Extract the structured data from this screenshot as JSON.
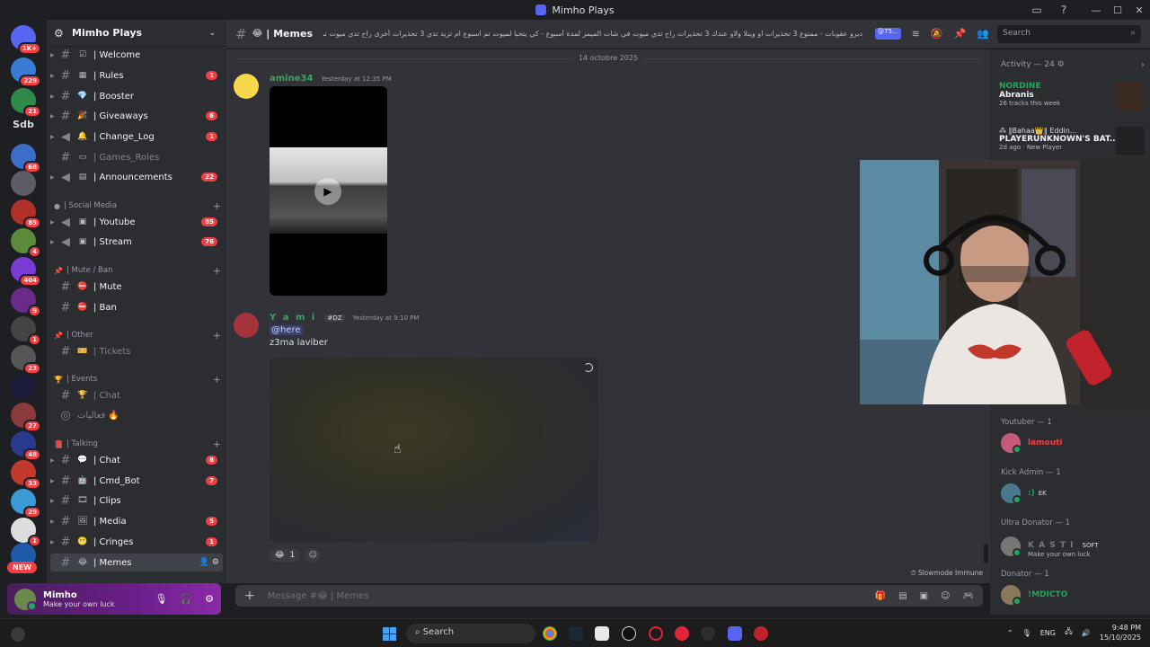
{
  "window": {
    "title": "Mimho Plays",
    "controls": [
      "—",
      "☐",
      "✕"
    ]
  },
  "rail": {
    "servers": [
      {
        "name": "home",
        "badge": "1K+",
        "color": "#5865f2"
      },
      {
        "name": "server-1",
        "badge": "229",
        "color": "#3a7bd5"
      },
      {
        "name": "server-2",
        "badge": "21",
        "color": "#2f8a4a"
      },
      {
        "name": "server-4",
        "badge": "68",
        "color": "#3b6ec7"
      },
      {
        "name": "server-5",
        "badge": "",
        "color": "#dbdee1"
      },
      {
        "name": "server-6",
        "badge": "85",
        "color": "#b0302a"
      },
      {
        "name": "server-7",
        "badge": "4",
        "color": "#5a8a3a"
      },
      {
        "name": "server-8",
        "badge": "404",
        "color": "#7a3ad5"
      },
      {
        "name": "server-9",
        "badge": "9",
        "color": "#6a2a8a"
      },
      {
        "name": "server-10",
        "badge": "1",
        "color": "#444"
      },
      {
        "name": "server-11",
        "badge": "23",
        "color": "#555"
      },
      {
        "name": "server-12",
        "badge": "",
        "color": "#1b1b3a"
      },
      {
        "name": "server-13",
        "badge": "27",
        "color": "#8a3a3a"
      },
      {
        "name": "server-14",
        "badge": "48",
        "color": "#2a3a8a"
      },
      {
        "name": "server-15",
        "badge": "33",
        "color": "#c0392b"
      },
      {
        "name": "server-16",
        "badge": "29",
        "color": "#3a9ad5"
      },
      {
        "name": "server-17",
        "badge": "1",
        "color": "#eee"
      },
      {
        "name": "server-18",
        "badge": "",
        "color": "#1e5aa8"
      }
    ],
    "text_server": "Sdb",
    "new_label": "NEW"
  },
  "guild": {
    "name": "Mimho Plays"
  },
  "channels": [
    {
      "name": "| Welcome",
      "emoji": "☑",
      "badge": ""
    },
    {
      "name": "| Rules",
      "emoji": "▦",
      "badge": "1"
    },
    {
      "name": "| Booster",
      "emoji": "💎",
      "badge": ""
    },
    {
      "name": "| Giveaways",
      "emoji": "🎉",
      "badge": "6"
    },
    {
      "name": "| Change_Log",
      "emoji": "🔔",
      "badge": "1"
    },
    {
      "name": "| Games_Roles",
      "emoji": "▭",
      "badge": ""
    },
    {
      "name": "| Announcements",
      "emoji": "▤",
      "badge": "22"
    }
  ],
  "categories": {
    "social": "| Social Media",
    "mute": "| Mute / Ban",
    "other": "| Other",
    "events": "| Events",
    "talking": "| Talking"
  },
  "social_channels": [
    {
      "name": "| Youtube",
      "badge": "85"
    },
    {
      "name": "| Stream",
      "badge": "76"
    }
  ],
  "mute_channels": [
    {
      "name": "| Mute"
    },
    {
      "name": "| Ban"
    }
  ],
  "other_channels": [
    {
      "name": "| Tickets"
    }
  ],
  "event_channels": [
    {
      "name": "| Chat"
    },
    {
      "name": "فعاليات 🔥"
    }
  ],
  "talking_channels": [
    {
      "name": "| Chat",
      "badge": "8"
    },
    {
      "name": "| Cmd_Bot",
      "badge": "7"
    },
    {
      "name": "| Clips",
      "badge": ""
    },
    {
      "name": "| Media",
      "badge": "5"
    },
    {
      "name": "| Cringes",
      "badge": "1"
    },
    {
      "name": "| Memes",
      "badge": ""
    }
  ],
  "user": {
    "name": "Mimho",
    "status": "Make your own luck"
  },
  "header": {
    "channel": "| Memes",
    "topic": "دبرو عقوبات - ممنوع 3 تحذيرات او وينلا ولاو عندك 3 تحذيرات راح تدي ميوت في شات الميمز لمدة أسبوع - كي يتحبا لميوت تم اسبوع ام تزيد تدي 3 تحذيرات أخرى راح تدي ميوت تم شهر من شات لميمز",
    "mention_pill": "@75...",
    "search_placeholder": "Search"
  },
  "messages": {
    "date_divider": "14 octobre 2025",
    "first": {
      "author": "amine34",
      "timestamp": "Yesterday at 12:35 PM",
      "author_color": "#3ba55c"
    },
    "second": {
      "author": "Y a m i",
      "tag": "#DZ",
      "timestamp": "Yesterday at 9:10 PM",
      "mention": "@here",
      "text": "z3ma laviber",
      "author_color": "#3ba55c",
      "reaction_count": "1"
    },
    "slowmode": "Slowmode Immune"
  },
  "composer": {
    "placeholder": "Message #😂 | Memes"
  },
  "activity": {
    "header": "Activity — 24",
    "card1": {
      "user": "NORDINE",
      "title": "Abranis",
      "sub": "26 tracks this week"
    },
    "card2": {
      "user": "⁂ ‖Bahaa👑‖ Eddin...",
      "title": "PLAYERUNKNOWN'S BAT...",
      "sub": "2d ago · New Player"
    }
  },
  "member_roles": [
    {
      "role": "Youtuber — 1",
      "member": "lamouti",
      "color": "#f23f43",
      "tag": "",
      "sub": ""
    },
    {
      "role": "Kick Admin — 1",
      "member": ":)",
      "color": "#23a55a",
      "tag": "EK",
      "sub": ""
    },
    {
      "role": "Ultra Donator — 1",
      "member": "K A S T I",
      "color": "#7a7a7a",
      "tag": "SOFT",
      "sub": "Make your own luck"
    },
    {
      "role": "Donator — 1",
      "member": "!MDICTO",
      "color": "#23a55a",
      "tag": "",
      "sub": ""
    }
  ],
  "taskbar": {
    "search": "Search",
    "lang": "ENG",
    "time": "9:48 PM",
    "date": "15/10/2025"
  }
}
